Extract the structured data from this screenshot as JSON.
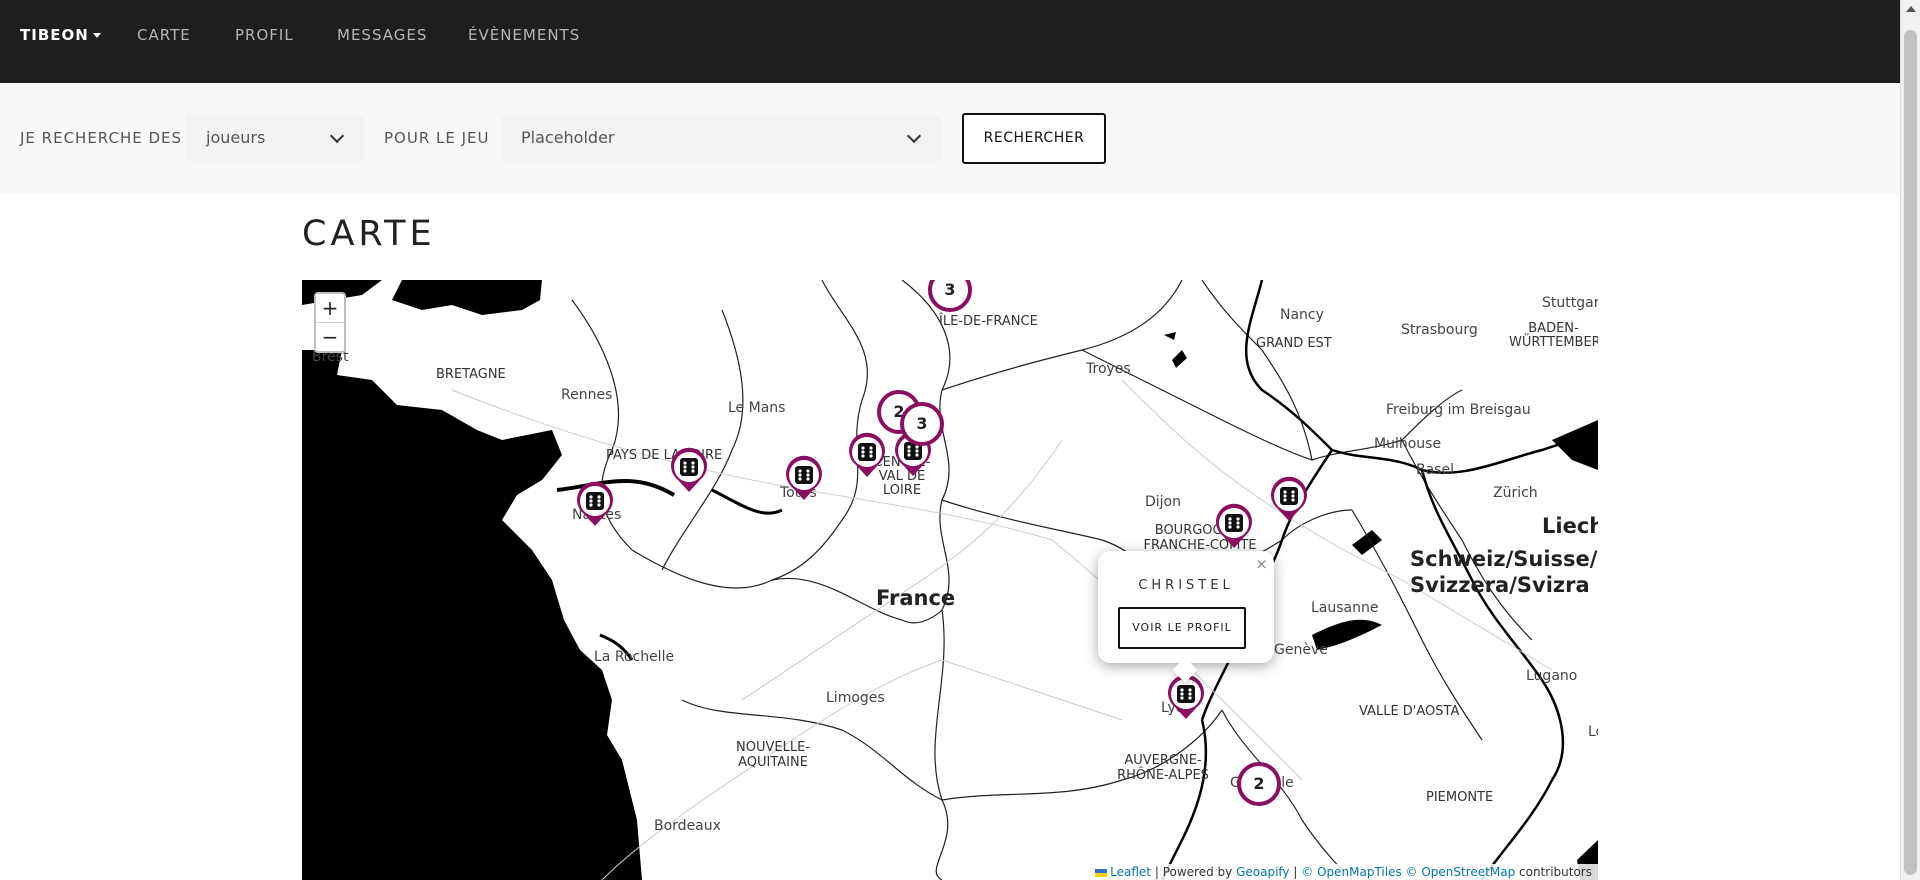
{
  "nav": {
    "brand": "TIBEON",
    "items": [
      "CARTE",
      "PROFIL",
      "MESSAGES",
      "ÉVÈNEMENTS"
    ]
  },
  "search": {
    "label_search": "JE RECHERCHE DES",
    "select_type": "joueurs",
    "label_game": "POUR LE JEU",
    "select_game_placeholder": "Placeholder",
    "button": "RECHERCHER"
  },
  "page": {
    "title": "CARTE"
  },
  "map": {
    "zoom_in": "+",
    "zoom_out": "−",
    "country": "France",
    "country_ch": "Schweiz/Suisse/ Svizzera/Svizra",
    "country_li": "Liecht",
    "cities": [
      "Brest",
      "Rennes",
      "Le Mans",
      "Nantes",
      "Tours",
      "La Rochelle",
      "Limoges",
      "Bordeaux",
      "Troyes",
      "Nancy",
      "Strasbourg",
      "Stuttgart",
      "Dijon",
      "Mulhouse",
      "Basel",
      "Zürich",
      "Freiburg im Breisgau",
      "Lausanne",
      "Genève",
      "Lyon",
      "Lugano",
      "Grenoble",
      "Lo"
    ],
    "regions": [
      "BRETAGNE",
      "PAYS DE LA LOIRE",
      "CENTRE-VAL DE LOIRE",
      "ÎLE-DE-FRANCE",
      "GRAND EST",
      "BADEN-WÜRTTEMBERG",
      "BOURGOGNE-FRANCHE-COMTE",
      "NOUVELLE-AQUITAINE",
      "AUVERGNE-RHÔNE-ALPES",
      "VALLE D'AOSTA",
      "PIEMONTE"
    ],
    "clusters": [
      "3",
      "2",
      "3",
      "2"
    ],
    "popup": {
      "name": "CHRISTEL",
      "button": "VOIR LE PROFIL",
      "close": "×"
    },
    "attribution": {
      "leaflet": "Leaflet",
      "powered": "| Powered by",
      "geoapify": "Geoapify",
      "sep": "|",
      "omt": "© OpenMapTiles",
      "osm": "© OpenStreetMap",
      "contributors": "contributors"
    }
  },
  "colors": {
    "navbar": "#1e1e1e",
    "marker": "#8a0f5f",
    "searchbar": "#f7f8f9"
  }
}
